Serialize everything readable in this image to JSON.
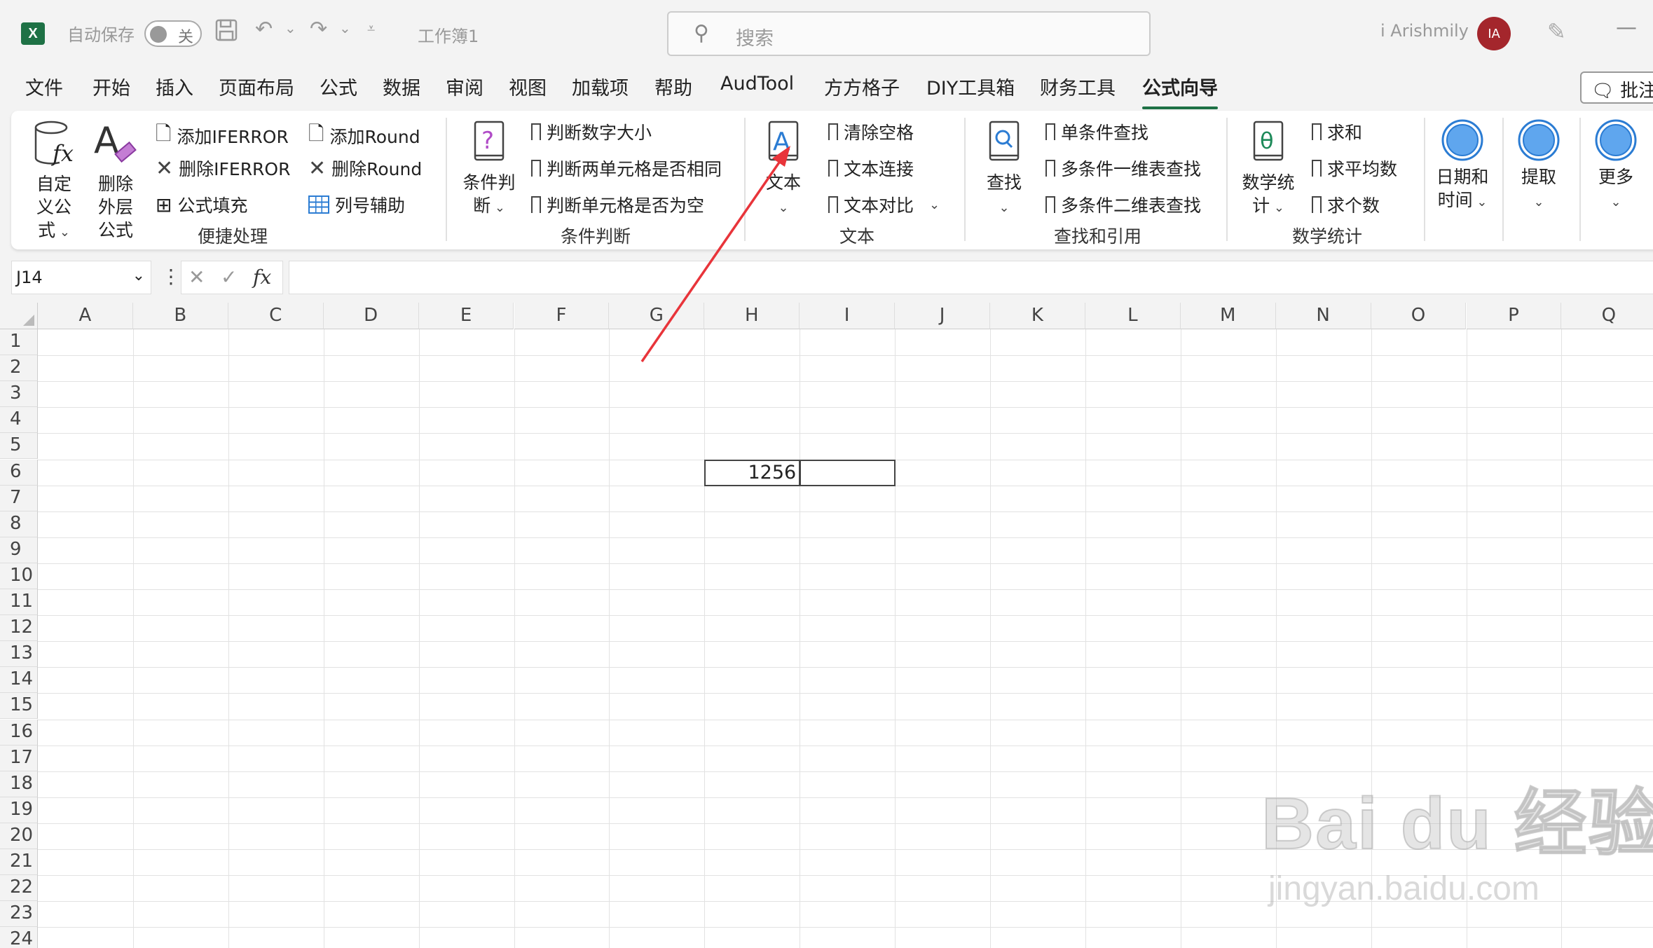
{
  "titlebar": {
    "app_icon": "X",
    "autosave_label": "自动保存",
    "autosave_state": "关",
    "doc_title": "工作簿1",
    "search_placeholder": "搜索",
    "user_name": "i Arishmily",
    "avatar_initials": "IA",
    "minimize": "—"
  },
  "tabs": [
    {
      "label": "文件"
    },
    {
      "label": "开始"
    },
    {
      "label": "插入"
    },
    {
      "label": "页面布局"
    },
    {
      "label": "公式"
    },
    {
      "label": "数据"
    },
    {
      "label": "审阅"
    },
    {
      "label": "视图"
    },
    {
      "label": "加载项"
    },
    {
      "label": "帮助"
    },
    {
      "label": "AudTool"
    },
    {
      "label": "方方格子"
    },
    {
      "label": "DIY工具箱"
    },
    {
      "label": "财务工具"
    },
    {
      "label": "公式向导"
    }
  ],
  "active_tab": "公式向导",
  "comment_button": "批注",
  "ribbon": {
    "quick": {
      "custom_formula": "自定义公式",
      "delete_outer": "删除外层公式",
      "add_iferror": "添加IFERROR",
      "del_iferror": "删除IFERROR",
      "formula_fill": "公式填充",
      "add_round": "添加Round",
      "del_round": "删除Round",
      "col_helper": "列号辅助",
      "group_label": "便捷处理"
    },
    "cond": {
      "big": "条件判断",
      "item1": "判断数字大小",
      "item2": "判断两单元格是否相同",
      "item3": "判断单元格是否为空",
      "group_label": "条件判断"
    },
    "text": {
      "big": "文本",
      "item1": "清除空格",
      "item2": "文本连接",
      "item3": "文本对比",
      "group_label": "文本"
    },
    "lookup": {
      "big": "查找",
      "item1": "单条件查找",
      "item2": "多条件一维表查找",
      "item3": "多条件二维表查找",
      "group_label": "查找和引用"
    },
    "math": {
      "big": "数学统计",
      "item1": "求和",
      "item2": "求平均数",
      "item3": "求个数",
      "group_label": "数学统计"
    },
    "datetime": "日期和时间",
    "extract": "提取",
    "more": "更多"
  },
  "formula_bar": {
    "name_box": "J14",
    "formula": ""
  },
  "sheet": {
    "columns": [
      "A",
      "B",
      "C",
      "D",
      "E",
      "F",
      "G",
      "H",
      "I",
      "J",
      "K",
      "L",
      "M",
      "N",
      "O",
      "P",
      "Q"
    ],
    "rows": [
      "1",
      "2",
      "3",
      "4",
      "5",
      "6",
      "7",
      "8",
      "9",
      "10",
      "11",
      "12",
      "13",
      "14",
      "15",
      "16",
      "17",
      "18",
      "19",
      "20",
      "21",
      "22",
      "23",
      "24"
    ],
    "cell_H6": "1256",
    "cell_I6": ""
  },
  "watermark": {
    "main": "Bai du 经验",
    "sub": "jingyan.baidu.com"
  },
  "colors": {
    "accent_green": "#1e7145",
    "avatar_red": "#a4262c",
    "arrow_red": "#e8343a",
    "icon_blue": "#2b7cd3"
  }
}
